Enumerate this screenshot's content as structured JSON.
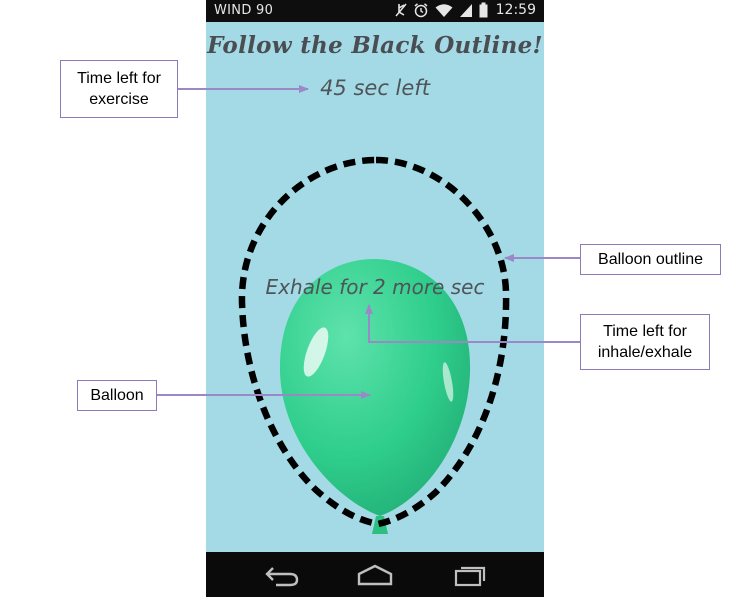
{
  "status_bar": {
    "carrier": "WIND 90",
    "time": "12:59",
    "icons": [
      "mute-icon",
      "alarm-icon",
      "wifi-icon",
      "signal-icon",
      "battery-icon"
    ]
  },
  "app": {
    "title": "Follow the Black Outline!",
    "exercise_time_left": "45 sec left",
    "breath_instruction": "Exhale for 2 more sec",
    "balloon_color": "#2fce8c",
    "background_color": "#a3dae6",
    "outline_color": "#000000"
  },
  "nav_bar": {
    "buttons": [
      "back-icon",
      "home-icon",
      "recent-apps-icon"
    ]
  },
  "annotations": {
    "time_left_exercise": {
      "line1": "Time left for",
      "line2": "exercise"
    },
    "balloon_outline": "Balloon outline",
    "time_left_breath": {
      "line1": "Time left for",
      "line2": "inhale/exhale"
    },
    "balloon": "Balloon",
    "arrow_color": "#9b88c6"
  }
}
